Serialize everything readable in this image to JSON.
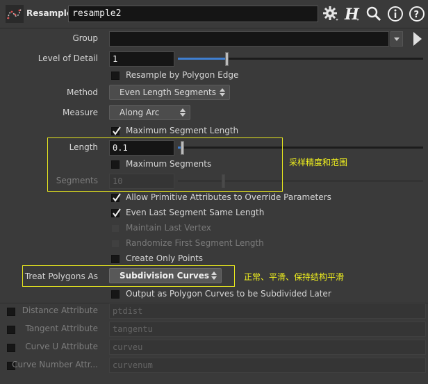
{
  "header": {
    "node_type": "Resample",
    "node_name": "resample2",
    "icons": [
      "resample-node-icon",
      "gear-icon",
      "houdini-help-h-icon",
      "search-icon",
      "info-icon",
      "help-icon"
    ]
  },
  "params": {
    "group": {
      "label": "Group",
      "value": ""
    },
    "lod": {
      "label": "Level of Detail",
      "value": "1",
      "slider_fraction": 0.2
    },
    "by_edge": {
      "label": "Resample by Polygon Edge",
      "checked": false
    },
    "method": {
      "label": "Method",
      "value": "Even Length Segments"
    },
    "measure": {
      "label": "Measure",
      "value": "Along Arc"
    },
    "max_seg_len": {
      "label": "Maximum Segment Length",
      "checked": true
    },
    "length": {
      "label": "Length",
      "value": "0.1",
      "slider_fraction": 0.02
    },
    "max_segs": {
      "label": "Maximum Segments",
      "checked": false
    },
    "segments": {
      "label": "Segments",
      "value": "10",
      "enabled": false
    },
    "allow_prim": {
      "label": "Allow Primitive Attributes to Override Parameters",
      "checked": true
    },
    "even_last": {
      "label": "Even Last Segment Same Length",
      "checked": true
    },
    "maintain_last": {
      "label": "Maintain Last Vertex",
      "checked": false,
      "enabled": false
    },
    "randomize_first": {
      "label": "Randomize First Segment Length",
      "checked": false,
      "enabled": false
    },
    "create_only": {
      "label": "Create Only Points",
      "checked": false
    },
    "treat_polys": {
      "label": "Treat Polygons As",
      "value": "Subdivision Curves"
    },
    "output_poly": {
      "label": "Output as Polygon Curves to be Subdivided Later",
      "checked": false
    },
    "dist_attr": {
      "label": "Distance Attribute",
      "value": "ptdist"
    },
    "tangent_attr": {
      "label": "Tangent Attribute",
      "value": "tangentu"
    },
    "curveu_attr": {
      "label": "Curve U Attribute",
      "value": "curveu"
    },
    "curvenum_attr": {
      "label": "Curve Number Attr...",
      "value": "curvenum"
    }
  },
  "annotations": {
    "length_note": "采样精度和范围",
    "treat_note": "正常、平滑、保持结构平滑"
  },
  "colors": {
    "panel_bg": "#3a3a3a",
    "field_bg": "#151515",
    "slider_accent": "#3f7fd1",
    "annotation": "#e6e61e"
  }
}
